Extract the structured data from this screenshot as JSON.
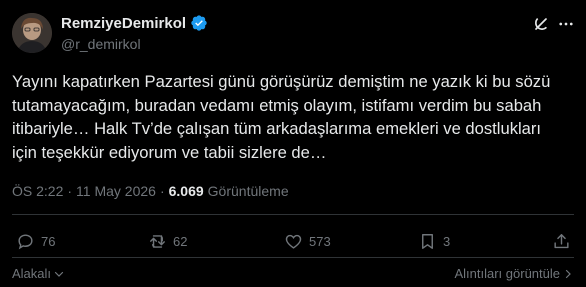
{
  "author": {
    "display_name": "RemziyeDemirkol",
    "handle": "@r_demirkol",
    "verified": true
  },
  "tweet": {
    "text": "Yayını kapatırken Pazartesi günü görüşürüz demiştim ne yazık ki bu sözü\ntutamayacağım, buradan vedamı etmiş olayım, istifamı verdim bu sabah\nitibariyle… Halk Tv’de çalışan tüm arkadaşlarıma emekleri ve dostlukları\niçin teşekkür ediyorum ve tabii sizlere de…"
  },
  "meta": {
    "time": "ÖS 2:22",
    "separator": "·",
    "date": "11 May 2026",
    "views_count": "6.069",
    "views_label": "Görüntüleme"
  },
  "actions": {
    "replies": "76",
    "reposts": "62",
    "likes": "573",
    "bookmarks": "3"
  },
  "footer": {
    "relevant_label": "Alakalı",
    "quotes_label": "Alıntıları görüntüle"
  },
  "colors": {
    "background": "#000000",
    "text": "#e7e9ea",
    "muted": "#71767b",
    "verified": "#1d9bf0"
  }
}
